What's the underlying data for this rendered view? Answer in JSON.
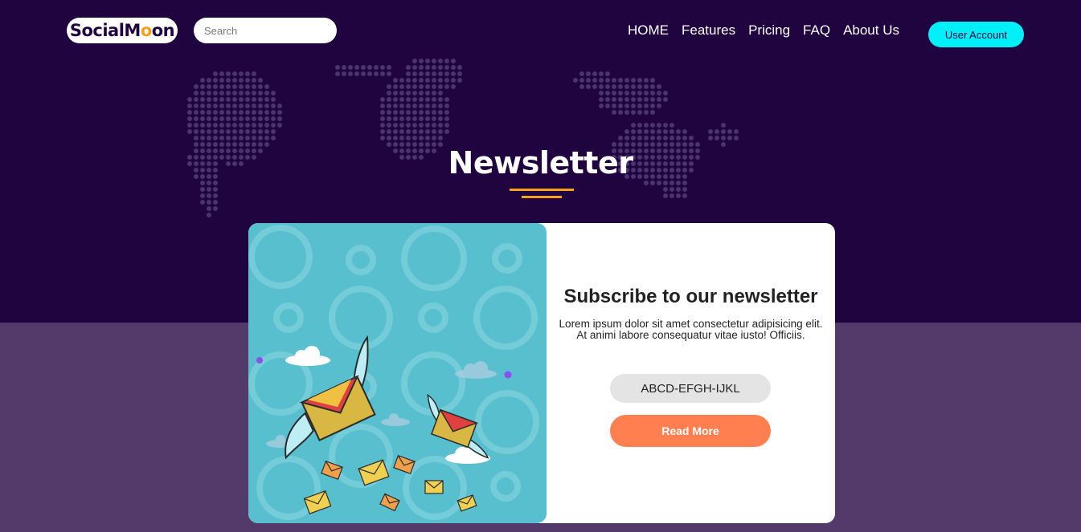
{
  "header": {
    "logo_prefix": "SocialM",
    "logo_accent": "o",
    "logo_suffix": "on",
    "search_placeholder": "Search",
    "nav": [
      {
        "label": "HOME"
      },
      {
        "label": "Features"
      },
      {
        "label": "Pricing"
      },
      {
        "label": "FAQ"
      },
      {
        "label": "About Us"
      }
    ],
    "user_button": "User Account"
  },
  "hero": {
    "title": "Newsletter"
  },
  "card": {
    "title": "Subscribe to our newsletter",
    "text": "Lorem ipsum dolor sit amet consectetur adipisicing elit. At animi labore consequatur vitae iusto! Officiis.",
    "code": "ABCD-EFGH-IJKL",
    "button": "Read More"
  },
  "colors": {
    "hero_bg": "#1f0440",
    "lower_bg": "#533a6b",
    "accent_cyan": "#00f0f8",
    "accent_orange": "#ff7f50",
    "underline": "#f7a21b",
    "illustration_bg": "#58bfcf"
  }
}
